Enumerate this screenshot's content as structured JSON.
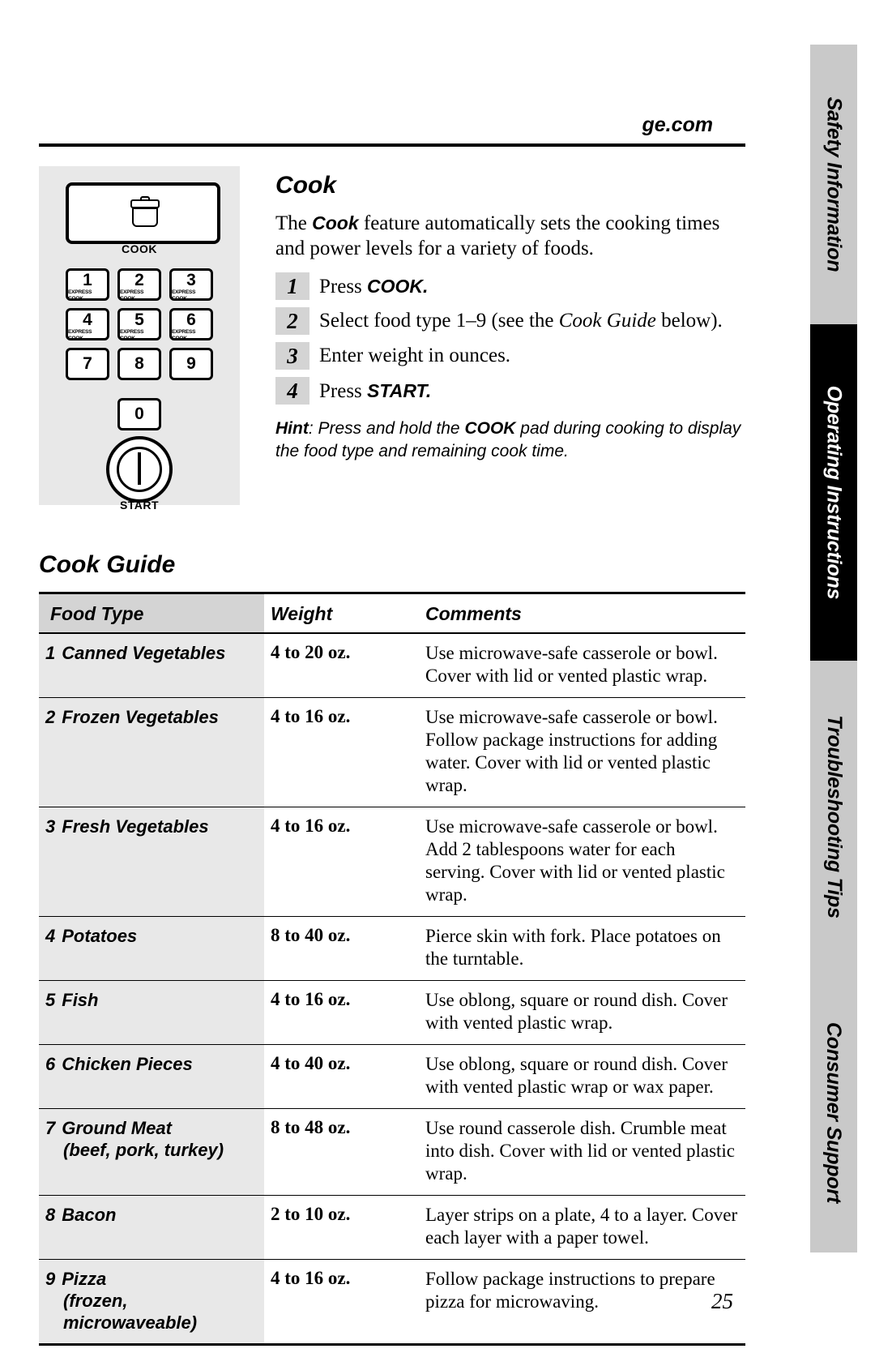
{
  "header": {
    "site": "ge.com",
    "page_number": "25"
  },
  "side_tabs": [
    {
      "label": "Safety Information",
      "style": "grey"
    },
    {
      "label": "Operating Instructions",
      "style": "black"
    },
    {
      "label": "Troubleshooting Tips",
      "style": "grey"
    },
    {
      "label": "Consumer Support",
      "style": "grey"
    }
  ],
  "keypad": {
    "cook_icon": "pot-icon",
    "cook_label": "COOK",
    "start_label": "START",
    "keys": [
      {
        "num": "1",
        "sub": "EXPRESS COOK"
      },
      {
        "num": "2",
        "sub": "EXPRESS COOK"
      },
      {
        "num": "3",
        "sub": "EXPRESS COOK"
      },
      {
        "num": "4",
        "sub": "EXPRESS COOK"
      },
      {
        "num": "5",
        "sub": "EXPRESS COOK"
      },
      {
        "num": "6",
        "sub": "EXPRESS COOK"
      },
      {
        "num": "7",
        "sub": ""
      },
      {
        "num": "8",
        "sub": ""
      },
      {
        "num": "9",
        "sub": ""
      }
    ],
    "zero": {
      "num": "0",
      "sub": ""
    }
  },
  "cook": {
    "title": "Cook",
    "intro_pre": "The ",
    "intro_bold": "Cook",
    "intro_post": " feature automatically sets the cooking times and power levels for a variety of foods.",
    "steps": [
      {
        "num": "1",
        "pre": "Press ",
        "bold": "COOK.",
        "post": "",
        "italic": "",
        "tail": ""
      },
      {
        "num": "2",
        "pre": "Select food type 1–9 (see the ",
        "bold": "",
        "italic": "Cook Guide",
        "tail": " below)."
      },
      {
        "num": "3",
        "pre": "Enter weight in ounces.",
        "bold": "",
        "italic": "",
        "tail": ""
      },
      {
        "num": "4",
        "pre": "Press ",
        "bold": "START.",
        "italic": "",
        "tail": ""
      }
    ],
    "hint_label": "Hint",
    "hint_pre": ": Press and hold the ",
    "hint_pad": "COOK",
    "hint_post": " pad during cooking to display the food type and remaining cook time."
  },
  "guide": {
    "title": "Cook Guide",
    "columns": [
      "Food Type",
      "Weight",
      "Comments"
    ],
    "rows": [
      {
        "index": "1",
        "food": "Canned Vegetables",
        "food_sub": "",
        "weight": "4 to 20 oz.",
        "comment": "Use microwave-safe casserole or bowl. Cover with lid or vented plastic wrap."
      },
      {
        "index": "2",
        "food": "Frozen Vegetables",
        "food_sub": "",
        "weight": "4 to 16 oz.",
        "comment": "Use microwave-safe casserole or bowl. Follow package instructions for adding water. Cover with lid or vented plastic wrap."
      },
      {
        "index": "3",
        "food": "Fresh Vegetables",
        "food_sub": "",
        "weight": "4 to 16 oz.",
        "comment": "Use microwave-safe casserole or bowl. Add 2 tablespoons water for each serving. Cover with lid or vented plastic wrap."
      },
      {
        "index": "4",
        "food": "Potatoes",
        "food_sub": "",
        "weight": "8 to 40 oz.",
        "comment": "Pierce skin with fork. Place potatoes on the turntable."
      },
      {
        "index": "5",
        "food": "Fish",
        "food_sub": "",
        "weight": "4 to 16 oz.",
        "comment": "Use oblong, square or round dish. Cover with vented plastic wrap."
      },
      {
        "index": "6",
        "food": "Chicken Pieces",
        "food_sub": "",
        "weight": "4 to 40 oz.",
        "comment": "Use oblong, square or round dish. Cover with vented plastic wrap or wax paper."
      },
      {
        "index": "7",
        "food": "Ground Meat",
        "food_sub": "(beef, pork, turkey)",
        "weight": "8 to 48 oz.",
        "comment": "Use round casserole dish. Crumble meat into dish. Cover with lid or vented plastic wrap."
      },
      {
        "index": "8",
        "food": "Bacon",
        "food_sub": "",
        "weight": "2 to 10 oz.",
        "comment": "Layer strips on a plate, 4 to a layer. Cover each layer with a paper towel."
      },
      {
        "index": "9",
        "food": "Pizza",
        "food_sub": "(frozen, microwaveable)",
        "weight": "4 to 16 oz.",
        "comment": "Follow package instructions to prepare pizza for microwaving."
      }
    ]
  }
}
